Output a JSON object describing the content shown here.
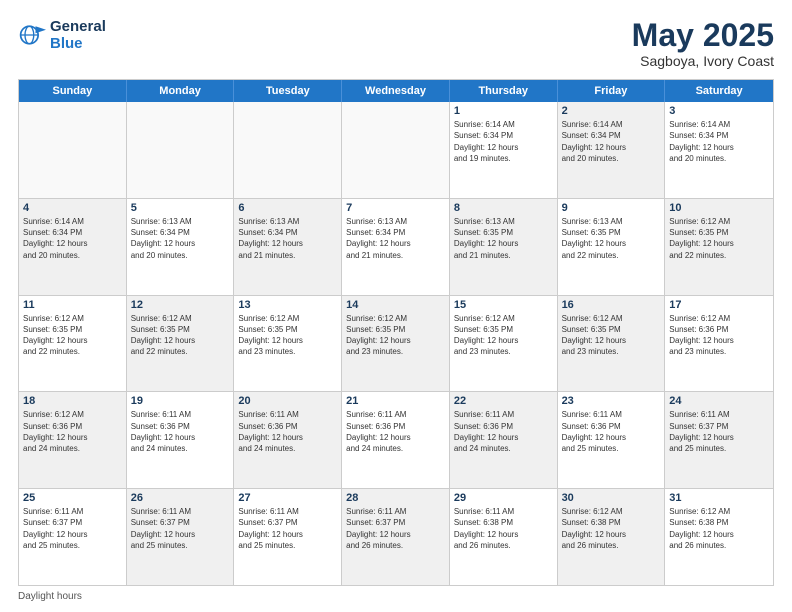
{
  "header": {
    "logo_line1": "General",
    "logo_line2": "Blue",
    "title": "May 2025",
    "subtitle": "Sagboya, Ivory Coast"
  },
  "days_of_week": [
    "Sunday",
    "Monday",
    "Tuesday",
    "Wednesday",
    "Thursday",
    "Friday",
    "Saturday"
  ],
  "weeks": [
    [
      {
        "day": "",
        "detail": "",
        "shaded": false,
        "empty": true
      },
      {
        "day": "",
        "detail": "",
        "shaded": false,
        "empty": true
      },
      {
        "day": "",
        "detail": "",
        "shaded": false,
        "empty": true
      },
      {
        "day": "",
        "detail": "",
        "shaded": false,
        "empty": true
      },
      {
        "day": "1",
        "detail": "Sunrise: 6:14 AM\nSunset: 6:34 PM\nDaylight: 12 hours\nand 19 minutes.",
        "shaded": false,
        "empty": false
      },
      {
        "day": "2",
        "detail": "Sunrise: 6:14 AM\nSunset: 6:34 PM\nDaylight: 12 hours\nand 20 minutes.",
        "shaded": true,
        "empty": false
      },
      {
        "day": "3",
        "detail": "Sunrise: 6:14 AM\nSunset: 6:34 PM\nDaylight: 12 hours\nand 20 minutes.",
        "shaded": false,
        "empty": false
      }
    ],
    [
      {
        "day": "4",
        "detail": "Sunrise: 6:14 AM\nSunset: 6:34 PM\nDaylight: 12 hours\nand 20 minutes.",
        "shaded": true,
        "empty": false
      },
      {
        "day": "5",
        "detail": "Sunrise: 6:13 AM\nSunset: 6:34 PM\nDaylight: 12 hours\nand 20 minutes.",
        "shaded": false,
        "empty": false
      },
      {
        "day": "6",
        "detail": "Sunrise: 6:13 AM\nSunset: 6:34 PM\nDaylight: 12 hours\nand 21 minutes.",
        "shaded": true,
        "empty": false
      },
      {
        "day": "7",
        "detail": "Sunrise: 6:13 AM\nSunset: 6:34 PM\nDaylight: 12 hours\nand 21 minutes.",
        "shaded": false,
        "empty": false
      },
      {
        "day": "8",
        "detail": "Sunrise: 6:13 AM\nSunset: 6:35 PM\nDaylight: 12 hours\nand 21 minutes.",
        "shaded": true,
        "empty": false
      },
      {
        "day": "9",
        "detail": "Sunrise: 6:13 AM\nSunset: 6:35 PM\nDaylight: 12 hours\nand 22 minutes.",
        "shaded": false,
        "empty": false
      },
      {
        "day": "10",
        "detail": "Sunrise: 6:12 AM\nSunset: 6:35 PM\nDaylight: 12 hours\nand 22 minutes.",
        "shaded": true,
        "empty": false
      }
    ],
    [
      {
        "day": "11",
        "detail": "Sunrise: 6:12 AM\nSunset: 6:35 PM\nDaylight: 12 hours\nand 22 minutes.",
        "shaded": false,
        "empty": false
      },
      {
        "day": "12",
        "detail": "Sunrise: 6:12 AM\nSunset: 6:35 PM\nDaylight: 12 hours\nand 22 minutes.",
        "shaded": true,
        "empty": false
      },
      {
        "day": "13",
        "detail": "Sunrise: 6:12 AM\nSunset: 6:35 PM\nDaylight: 12 hours\nand 23 minutes.",
        "shaded": false,
        "empty": false
      },
      {
        "day": "14",
        "detail": "Sunrise: 6:12 AM\nSunset: 6:35 PM\nDaylight: 12 hours\nand 23 minutes.",
        "shaded": true,
        "empty": false
      },
      {
        "day": "15",
        "detail": "Sunrise: 6:12 AM\nSunset: 6:35 PM\nDaylight: 12 hours\nand 23 minutes.",
        "shaded": false,
        "empty": false
      },
      {
        "day": "16",
        "detail": "Sunrise: 6:12 AM\nSunset: 6:35 PM\nDaylight: 12 hours\nand 23 minutes.",
        "shaded": true,
        "empty": false
      },
      {
        "day": "17",
        "detail": "Sunrise: 6:12 AM\nSunset: 6:36 PM\nDaylight: 12 hours\nand 23 minutes.",
        "shaded": false,
        "empty": false
      }
    ],
    [
      {
        "day": "18",
        "detail": "Sunrise: 6:12 AM\nSunset: 6:36 PM\nDaylight: 12 hours\nand 24 minutes.",
        "shaded": true,
        "empty": false
      },
      {
        "day": "19",
        "detail": "Sunrise: 6:11 AM\nSunset: 6:36 PM\nDaylight: 12 hours\nand 24 minutes.",
        "shaded": false,
        "empty": false
      },
      {
        "day": "20",
        "detail": "Sunrise: 6:11 AM\nSunset: 6:36 PM\nDaylight: 12 hours\nand 24 minutes.",
        "shaded": true,
        "empty": false
      },
      {
        "day": "21",
        "detail": "Sunrise: 6:11 AM\nSunset: 6:36 PM\nDaylight: 12 hours\nand 24 minutes.",
        "shaded": false,
        "empty": false
      },
      {
        "day": "22",
        "detail": "Sunrise: 6:11 AM\nSunset: 6:36 PM\nDaylight: 12 hours\nand 24 minutes.",
        "shaded": true,
        "empty": false
      },
      {
        "day": "23",
        "detail": "Sunrise: 6:11 AM\nSunset: 6:36 PM\nDaylight: 12 hours\nand 25 minutes.",
        "shaded": false,
        "empty": false
      },
      {
        "day": "24",
        "detail": "Sunrise: 6:11 AM\nSunset: 6:37 PM\nDaylight: 12 hours\nand 25 minutes.",
        "shaded": true,
        "empty": false
      }
    ],
    [
      {
        "day": "25",
        "detail": "Sunrise: 6:11 AM\nSunset: 6:37 PM\nDaylight: 12 hours\nand 25 minutes.",
        "shaded": false,
        "empty": false
      },
      {
        "day": "26",
        "detail": "Sunrise: 6:11 AM\nSunset: 6:37 PM\nDaylight: 12 hours\nand 25 minutes.",
        "shaded": true,
        "empty": false
      },
      {
        "day": "27",
        "detail": "Sunrise: 6:11 AM\nSunset: 6:37 PM\nDaylight: 12 hours\nand 25 minutes.",
        "shaded": false,
        "empty": false
      },
      {
        "day": "28",
        "detail": "Sunrise: 6:11 AM\nSunset: 6:37 PM\nDaylight: 12 hours\nand 26 minutes.",
        "shaded": true,
        "empty": false
      },
      {
        "day": "29",
        "detail": "Sunrise: 6:11 AM\nSunset: 6:38 PM\nDaylight: 12 hours\nand 26 minutes.",
        "shaded": false,
        "empty": false
      },
      {
        "day": "30",
        "detail": "Sunrise: 6:12 AM\nSunset: 6:38 PM\nDaylight: 12 hours\nand 26 minutes.",
        "shaded": true,
        "empty": false
      },
      {
        "day": "31",
        "detail": "Sunrise: 6:12 AM\nSunset: 6:38 PM\nDaylight: 12 hours\nand 26 minutes.",
        "shaded": false,
        "empty": false
      }
    ]
  ],
  "footer": {
    "note": "Daylight hours"
  }
}
